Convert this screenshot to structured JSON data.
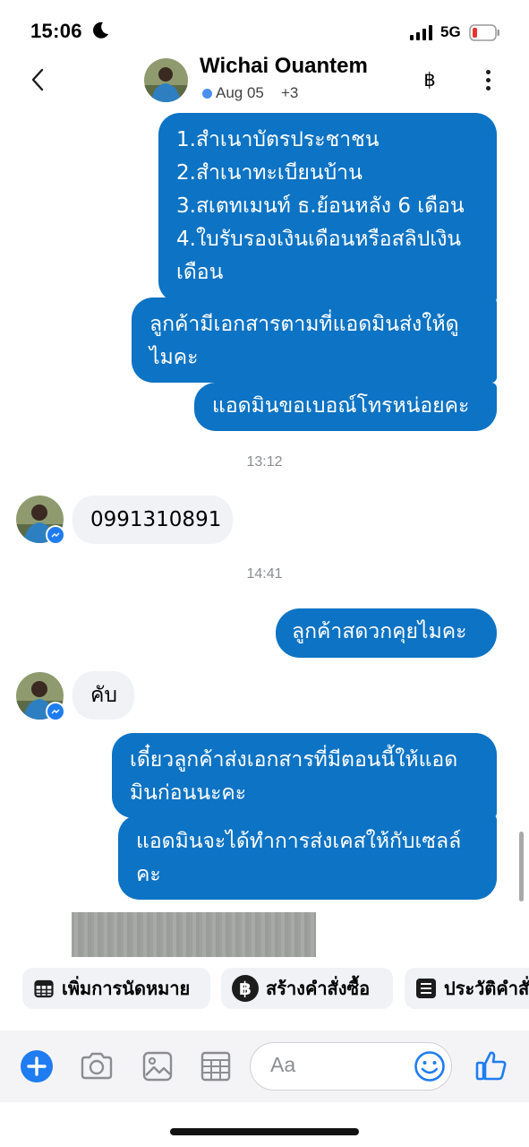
{
  "status_bar": {
    "time": "15:06",
    "network": "5G",
    "icons": [
      "moon-icon",
      "signal-icon",
      "battery-low-icon"
    ]
  },
  "header": {
    "contact_name": "Wichai Ouantem",
    "presence": "Aug 05",
    "more_count": "+3",
    "actions": [
      "back-icon",
      "baht-icon",
      "more-vert-icon"
    ],
    "presence_color": "#4a8ef0"
  },
  "messages": [
    {
      "dir": "out",
      "text": "1.สำเนาบัตรประชาชน\n2.สำเนาทะเบียนบ้าน\n3.สเตทเมนท์ ธ.ย้อนหลัง 6 เดือน\n4.ใบรับรองเงินเดือนหรือสลิปเงิน\nเดือน"
    },
    {
      "dir": "out",
      "text": "ลูกค้ามีเอกสารตามที่แอดมินส่งให้ดู\nไมคะ"
    },
    {
      "dir": "out",
      "text": "แอดมินขอเบอณ์โทรหน่อยคะ"
    },
    {
      "dir": "time",
      "text": "13:12"
    },
    {
      "dir": "in",
      "text": "0991310891"
    },
    {
      "dir": "time",
      "text": "14:41"
    },
    {
      "dir": "out",
      "text": "ลูกค้าสดวกคุยไมคะ"
    },
    {
      "dir": "in",
      "text": "คับ"
    },
    {
      "dir": "out",
      "text": "เดี๋ยวลูกค้าส่งเอกสารที่มีตอนนี้ให้แอด\nมินก่อนนะคะ"
    },
    {
      "dir": "out",
      "text": "แอดมินจะได้ทำการส่งเคสให้กับเซลล์\nคะ"
    }
  ],
  "quick_actions": [
    {
      "label": "เพิ่มการนัดหมาย",
      "icon": "calendar-icon"
    },
    {
      "label": "สร้างคำสั่งซื้อ",
      "icon": "baht-circle-icon"
    },
    {
      "label": "ประวัติคำสั่งซื้อ",
      "icon": "order-history-icon"
    }
  ],
  "composer": {
    "placeholder": "Aa",
    "tools": [
      "add-icon",
      "camera-icon",
      "gallery-icon",
      "keyboard-grid-icon",
      "emoji-icon",
      "like-icon"
    ]
  },
  "colors": {
    "outgoing_bubble": "#0d73c4",
    "incoming_bubble": "#f1f2f6",
    "accent": "#1f7cf1"
  }
}
